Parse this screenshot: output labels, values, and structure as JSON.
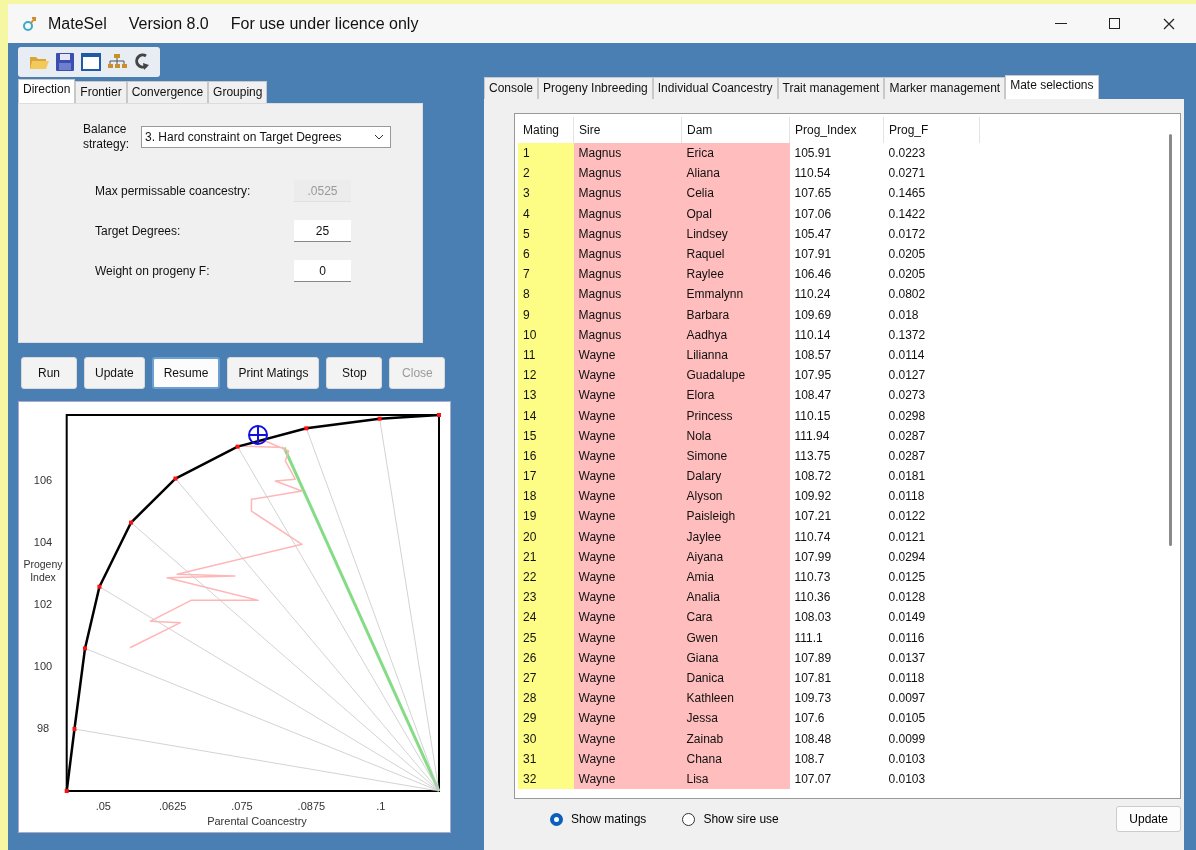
{
  "window": {
    "title": "MateSel",
    "version": "Version 8.0",
    "notice": "For use under licence only"
  },
  "left_tabs": [
    {
      "label": "Direction",
      "selected": true
    },
    {
      "label": "Frontier",
      "selected": false
    },
    {
      "label": "Convergence",
      "selected": false
    },
    {
      "label": "Grouping",
      "selected": false
    }
  ],
  "direction": {
    "strategy_label": "Balance strategy:",
    "strategy_value": "3. Hard constraint on Target Degrees",
    "fields": [
      {
        "label": "Max permissable coancestry:",
        "value": ".0525",
        "disabled": true
      },
      {
        "label": "Target Degrees:",
        "value": "25",
        "disabled": false
      },
      {
        "label": "Weight on progeny F:",
        "value": "0",
        "disabled": false
      }
    ]
  },
  "buttons": [
    {
      "label": "Run",
      "disabled": false,
      "focused": false
    },
    {
      "label": "Update",
      "disabled": false,
      "focused": false
    },
    {
      "label": "Resume",
      "disabled": false,
      "focused": true
    },
    {
      "label": "Print Matings",
      "disabled": false,
      "focused": false
    },
    {
      "label": "Stop",
      "disabled": false,
      "focused": false
    },
    {
      "label": "Close",
      "disabled": true,
      "focused": false
    }
  ],
  "frontier_chart": {
    "chart_data": {
      "type": "line",
      "xlabel": "Parental Coancestry",
      "ylabel": "Progeny Index",
      "x": [
        0.0434,
        0.0448,
        0.0467,
        0.0493,
        0.055,
        0.063,
        0.0742,
        0.0866,
        0.0998,
        0.1105
      ],
      "series": [
        {
          "color": "#000000",
          "marker": true,
          "values": [
            95.97,
            97.97,
            100.57,
            102.56,
            104.63,
            106.05,
            107.08,
            107.67,
            107.98,
            108.1
          ]
        },
        {
          "color": "#c8c8c8",
          "x": [
            0.0448,
            0.1105
          ],
          "values": [
            97.97,
            95.97
          ]
        },
        {
          "color": "#c8c8c8",
          "x": [
            0.0467,
            0.1105
          ],
          "values": [
            100.57,
            95.97
          ]
        },
        {
          "color": "#c8c8c8",
          "x": [
            0.0493,
            0.1105
          ],
          "values": [
            102.56,
            95.97
          ]
        },
        {
          "color": "#c8c8c8",
          "x": [
            0.055,
            0.1105
          ],
          "values": [
            104.63,
            95.97
          ]
        },
        {
          "color": "#c8c8c8",
          "x": [
            0.063,
            0.1105
          ],
          "values": [
            106.05,
            95.97
          ]
        },
        {
          "color": "#c8c8c8",
          "x": [
            0.0742,
            0.1105
          ],
          "values": [
            107.08,
            95.97
          ]
        },
        {
          "color": "#c8c8c8",
          "x": [
            0.0866,
            0.1105
          ],
          "values": [
            107.67,
            95.97
          ]
        },
        {
          "color": "#c8c8c8",
          "x": [
            0.0998,
            0.1105
          ],
          "values": [
            107.98,
            95.97
          ]
        },
        {
          "color": "#ffb6b6",
          "x": [
            0.0825,
            0.0743,
            0.0792,
            0.0834,
            0.0828,
            0.0846,
            0.081,
            0.0858,
            0.0767,
            0.0767,
            0.0858,
            0.0633,
            0.0737,
            0.0615,
            0.0779,
            0.0658,
            0.0585,
            0.0639,
            0.0548
          ],
          "values": [
            107.05,
            107.1,
            107.26,
            106.94,
            106.62,
            106.03,
            105.97,
            105.65,
            105.38,
            105.0,
            103.93,
            102.96,
            102.91,
            102.85,
            102.12,
            102.12,
            101.45,
            101.4,
            100.59
          ]
        },
        {
          "color": "#86dc86",
          "x": [
            0.0826,
            0.1105
          ],
          "values": [
            107.05,
            95.97
          ]
        }
      ],
      "xlim": [
        0.0434,
        0.1105
      ],
      "ylim": [
        95.97,
        108.1
      ],
      "xticks": [
        {
          "value": 0.05,
          "label": ".05"
        },
        {
          "value": 0.0625,
          "label": ".0625"
        },
        {
          "value": 0.075,
          "label": ".075"
        },
        {
          "value": 0.0875,
          "label": ".0875"
        },
        {
          "value": 0.1,
          "label": ".1"
        }
      ],
      "yticks": [
        98,
        100,
        102,
        104,
        106
      ]
    }
  },
  "right_tabs": [
    {
      "label": "Console",
      "selected": false
    },
    {
      "label": "Progeny Inbreeding",
      "selected": false
    },
    {
      "label": "Individual Coancestry",
      "selected": false
    },
    {
      "label": "Trait management",
      "selected": false
    },
    {
      "label": "Marker management",
      "selected": false
    },
    {
      "label": "Mate selections",
      "selected": true
    }
  ],
  "table": {
    "columns": [
      "Mating",
      "Sire",
      "Dam",
      "Prog_Index",
      "Prog_F"
    ],
    "rows": [
      [
        "1",
        "Magnus",
        "Erica",
        "105.91",
        "0.0223"
      ],
      [
        "2",
        "Magnus",
        "Aliana",
        "110.54",
        "0.0271"
      ],
      [
        "3",
        "Magnus",
        "Celia",
        "107.65",
        "0.1465"
      ],
      [
        "4",
        "Magnus",
        "Opal",
        "107.06",
        "0.1422"
      ],
      [
        "5",
        "Magnus",
        "Lindsey",
        "105.47",
        "0.0172"
      ],
      [
        "6",
        "Magnus",
        "Raquel",
        "107.91",
        "0.0205"
      ],
      [
        "7",
        "Magnus",
        "Raylee",
        "106.46",
        "0.0205"
      ],
      [
        "8",
        "Magnus",
        "Emmalynn",
        "110.24",
        "0.0802"
      ],
      [
        "9",
        "Magnus",
        "Barbara",
        "109.69",
        "0.018"
      ],
      [
        "10",
        "Magnus",
        "Aadhya",
        "110.14",
        "0.1372"
      ],
      [
        "11",
        "Wayne",
        "Lilianna",
        "108.57",
        "0.0114"
      ],
      [
        "12",
        "Wayne",
        "Guadalupe",
        "107.95",
        "0.0127"
      ],
      [
        "13",
        "Wayne",
        "Elora",
        "108.47",
        "0.0273"
      ],
      [
        "14",
        "Wayne",
        "Princess",
        "110.15",
        "0.0298"
      ],
      [
        "15",
        "Wayne",
        "Nola",
        "111.94",
        "0.0287"
      ],
      [
        "16",
        "Wayne",
        "Simone",
        "113.75",
        "0.0287"
      ],
      [
        "17",
        "Wayne",
        "Dalary",
        "108.72",
        "0.0181"
      ],
      [
        "18",
        "Wayne",
        "Alyson",
        "109.92",
        "0.0118"
      ],
      [
        "19",
        "Wayne",
        "Paisleigh",
        "107.21",
        "0.0122"
      ],
      [
        "20",
        "Wayne",
        "Jaylee",
        "110.74",
        "0.0121"
      ],
      [
        "21",
        "Wayne",
        "Aiyana",
        "107.99",
        "0.0294"
      ],
      [
        "22",
        "Wayne",
        "Amia",
        "110.73",
        "0.0125"
      ],
      [
        "23",
        "Wayne",
        "Analia",
        "110.36",
        "0.0128"
      ],
      [
        "24",
        "Wayne",
        "Cara",
        "108.03",
        "0.0149"
      ],
      [
        "25",
        "Wayne",
        "Gwen",
        "111.1",
        "0.0116"
      ],
      [
        "26",
        "Wayne",
        "Giana",
        "107.89",
        "0.0137"
      ],
      [
        "27",
        "Wayne",
        "Danica",
        "107.81",
        "0.0118"
      ],
      [
        "28",
        "Wayne",
        "Kathleen",
        "109.73",
        "0.0097"
      ],
      [
        "29",
        "Wayne",
        "Jessa",
        "107.6",
        "0.0105"
      ],
      [
        "30",
        "Wayne",
        "Zainab",
        "108.48",
        "0.0099"
      ],
      [
        "31",
        "Wayne",
        "Chana",
        "108.7",
        "0.0103"
      ],
      [
        "32",
        "Wayne",
        "Lisa",
        "107.07",
        "0.0103"
      ]
    ]
  },
  "view_options": [
    {
      "label": "Show matings",
      "selected": true
    },
    {
      "label": "Show sire use",
      "selected": false
    }
  ],
  "update_button": "Update"
}
